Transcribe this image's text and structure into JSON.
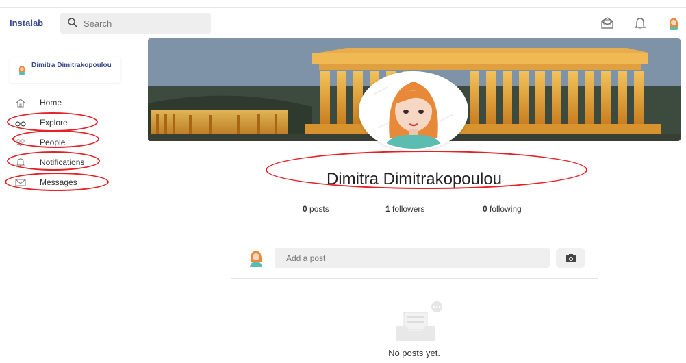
{
  "header": {
    "brand": "Instalab",
    "search_placeholder": "Search",
    "icons": [
      "mail-icon",
      "bell-icon",
      "user-avatar-icon"
    ]
  },
  "sidebar": {
    "user_name": "Dimitra Dimitrakopoulou",
    "items": [
      {
        "label": "Home",
        "icon": "home-icon"
      },
      {
        "label": "Explore",
        "icon": "binoculars-icon"
      },
      {
        "label": "People",
        "icon": "people-icon"
      },
      {
        "label": "Notifications",
        "icon": "bell-icon"
      },
      {
        "label": "Messages",
        "icon": "envelope-icon"
      }
    ]
  },
  "profile": {
    "name": "Dimitra Dimitrakopoulou",
    "stats": [
      {
        "count": "0",
        "label": "posts"
      },
      {
        "count": "1",
        "label": "followers"
      },
      {
        "count": "0",
        "label": "following"
      }
    ]
  },
  "composer": {
    "placeholder": "Add a post"
  },
  "feed": {
    "empty_text": "No posts yet."
  },
  "colors": {
    "brand": "#3b4a8c",
    "annotation": "#e52026",
    "avatar_hair": "#e8893a",
    "avatar_shirt": "#5bbcb2"
  }
}
